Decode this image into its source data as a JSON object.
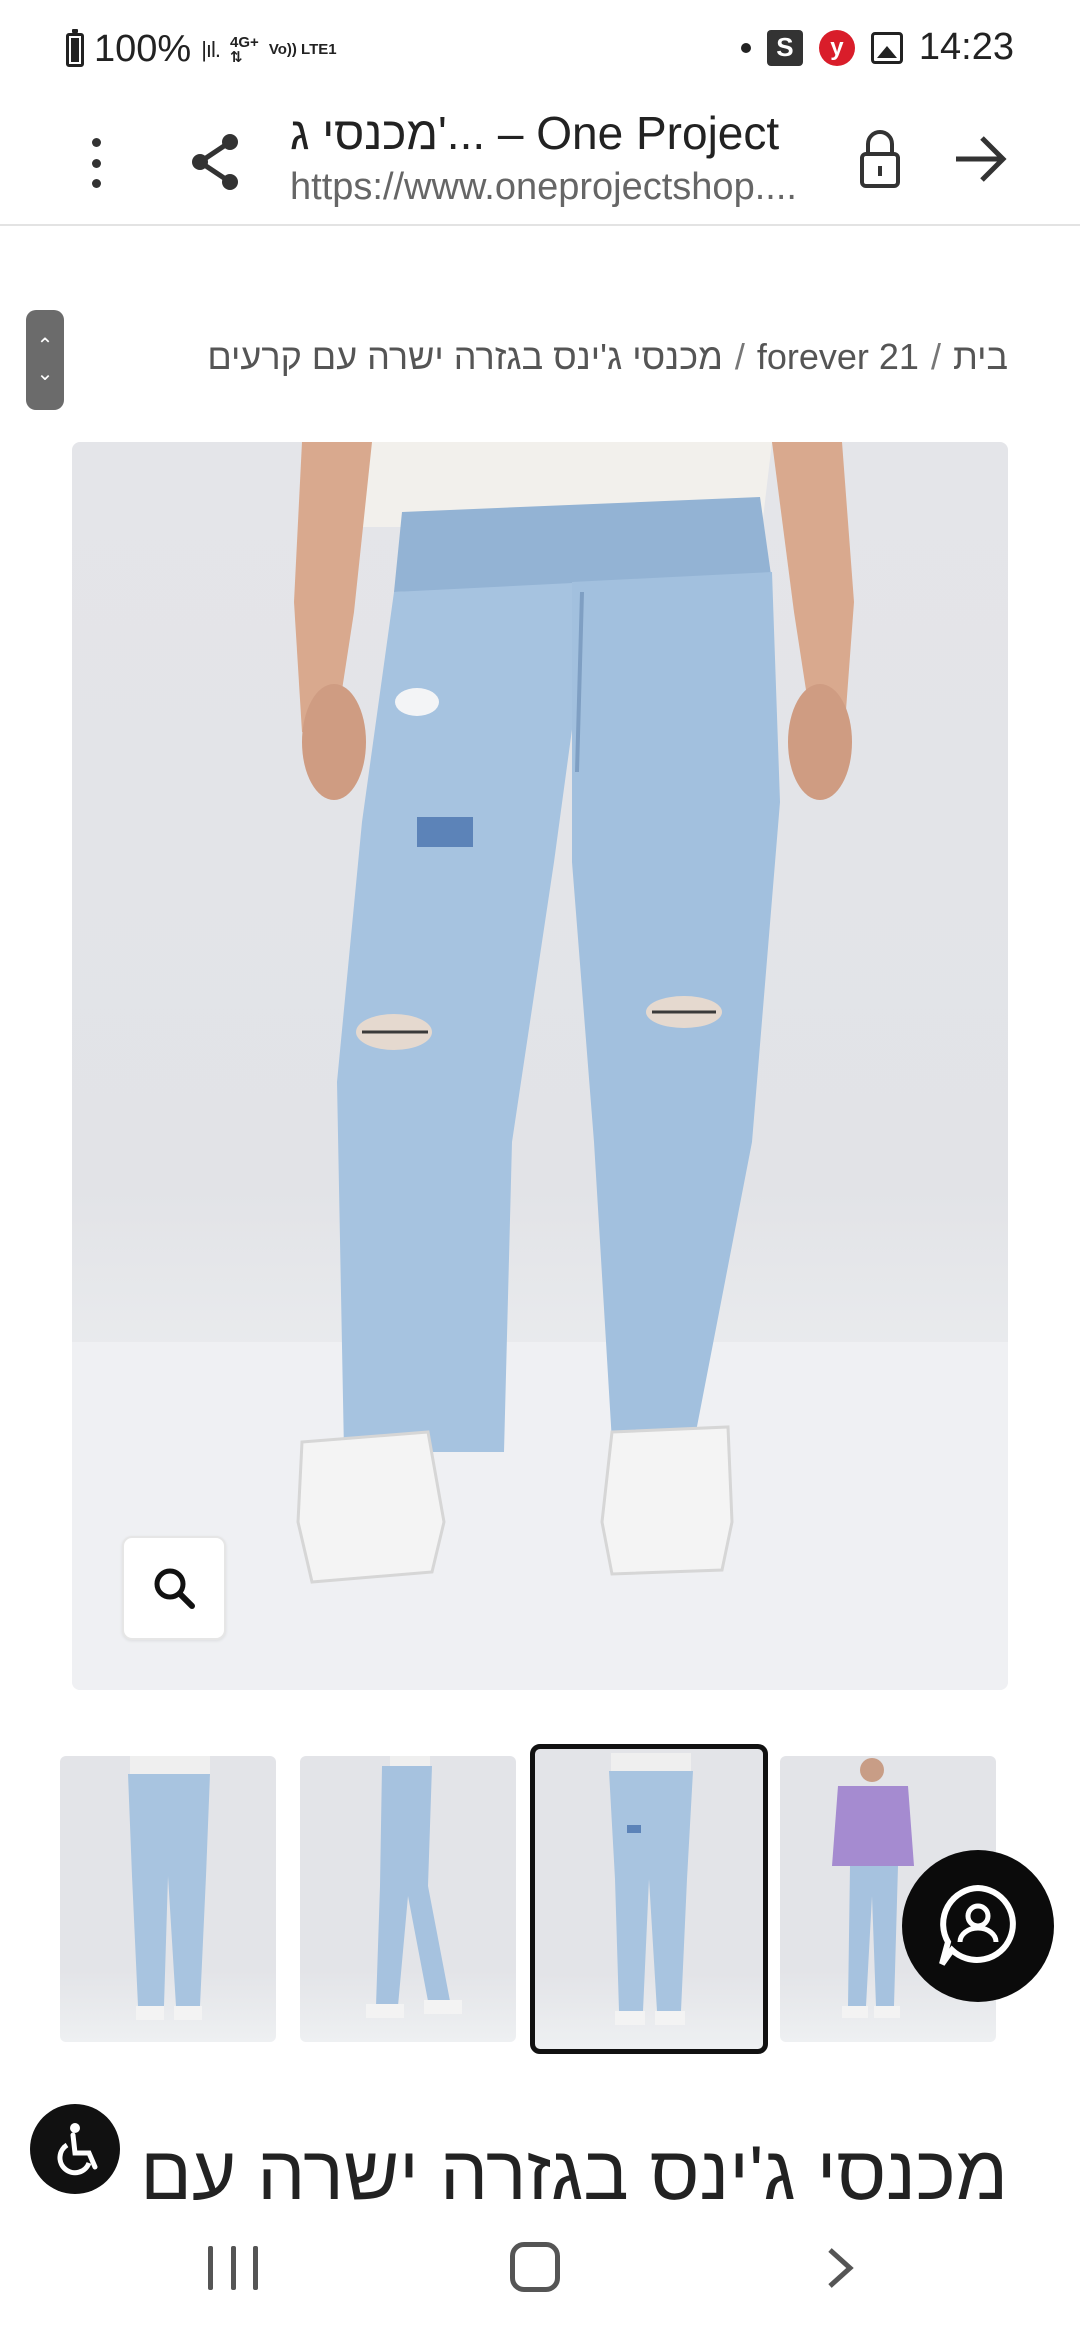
{
  "status_bar": {
    "battery": "100%",
    "network_top": "4G+",
    "volte": "Vo)) LTE1",
    "time": "14:23",
    "s_icon_label": "S",
    "y_icon_label": "y"
  },
  "browser": {
    "page_title": "מכנסי ג'... – One Project",
    "url": "https://www.oneprojectshop....",
    "icons": [
      "more-vert-icon",
      "share-icon",
      "lock-icon",
      "forward-arrow-icon"
    ]
  },
  "breadcrumb": {
    "home": "בית",
    "category": "forever 21",
    "current": "מכנסי ג'ינס בגזרה ישרה עם קרעים",
    "separator": "/"
  },
  "gallery": {
    "selected_index": 2,
    "thumbnails": [
      "back-view",
      "side-view",
      "front-view",
      "full-outfit-view"
    ]
  },
  "product": {
    "title": "מכנסי ג'ינס בגזרה ישרה עם"
  },
  "colors": {
    "denim": "#a9c6e2",
    "image_bg": "#e4e5e9",
    "accent_dark": "#0b0b0b"
  }
}
